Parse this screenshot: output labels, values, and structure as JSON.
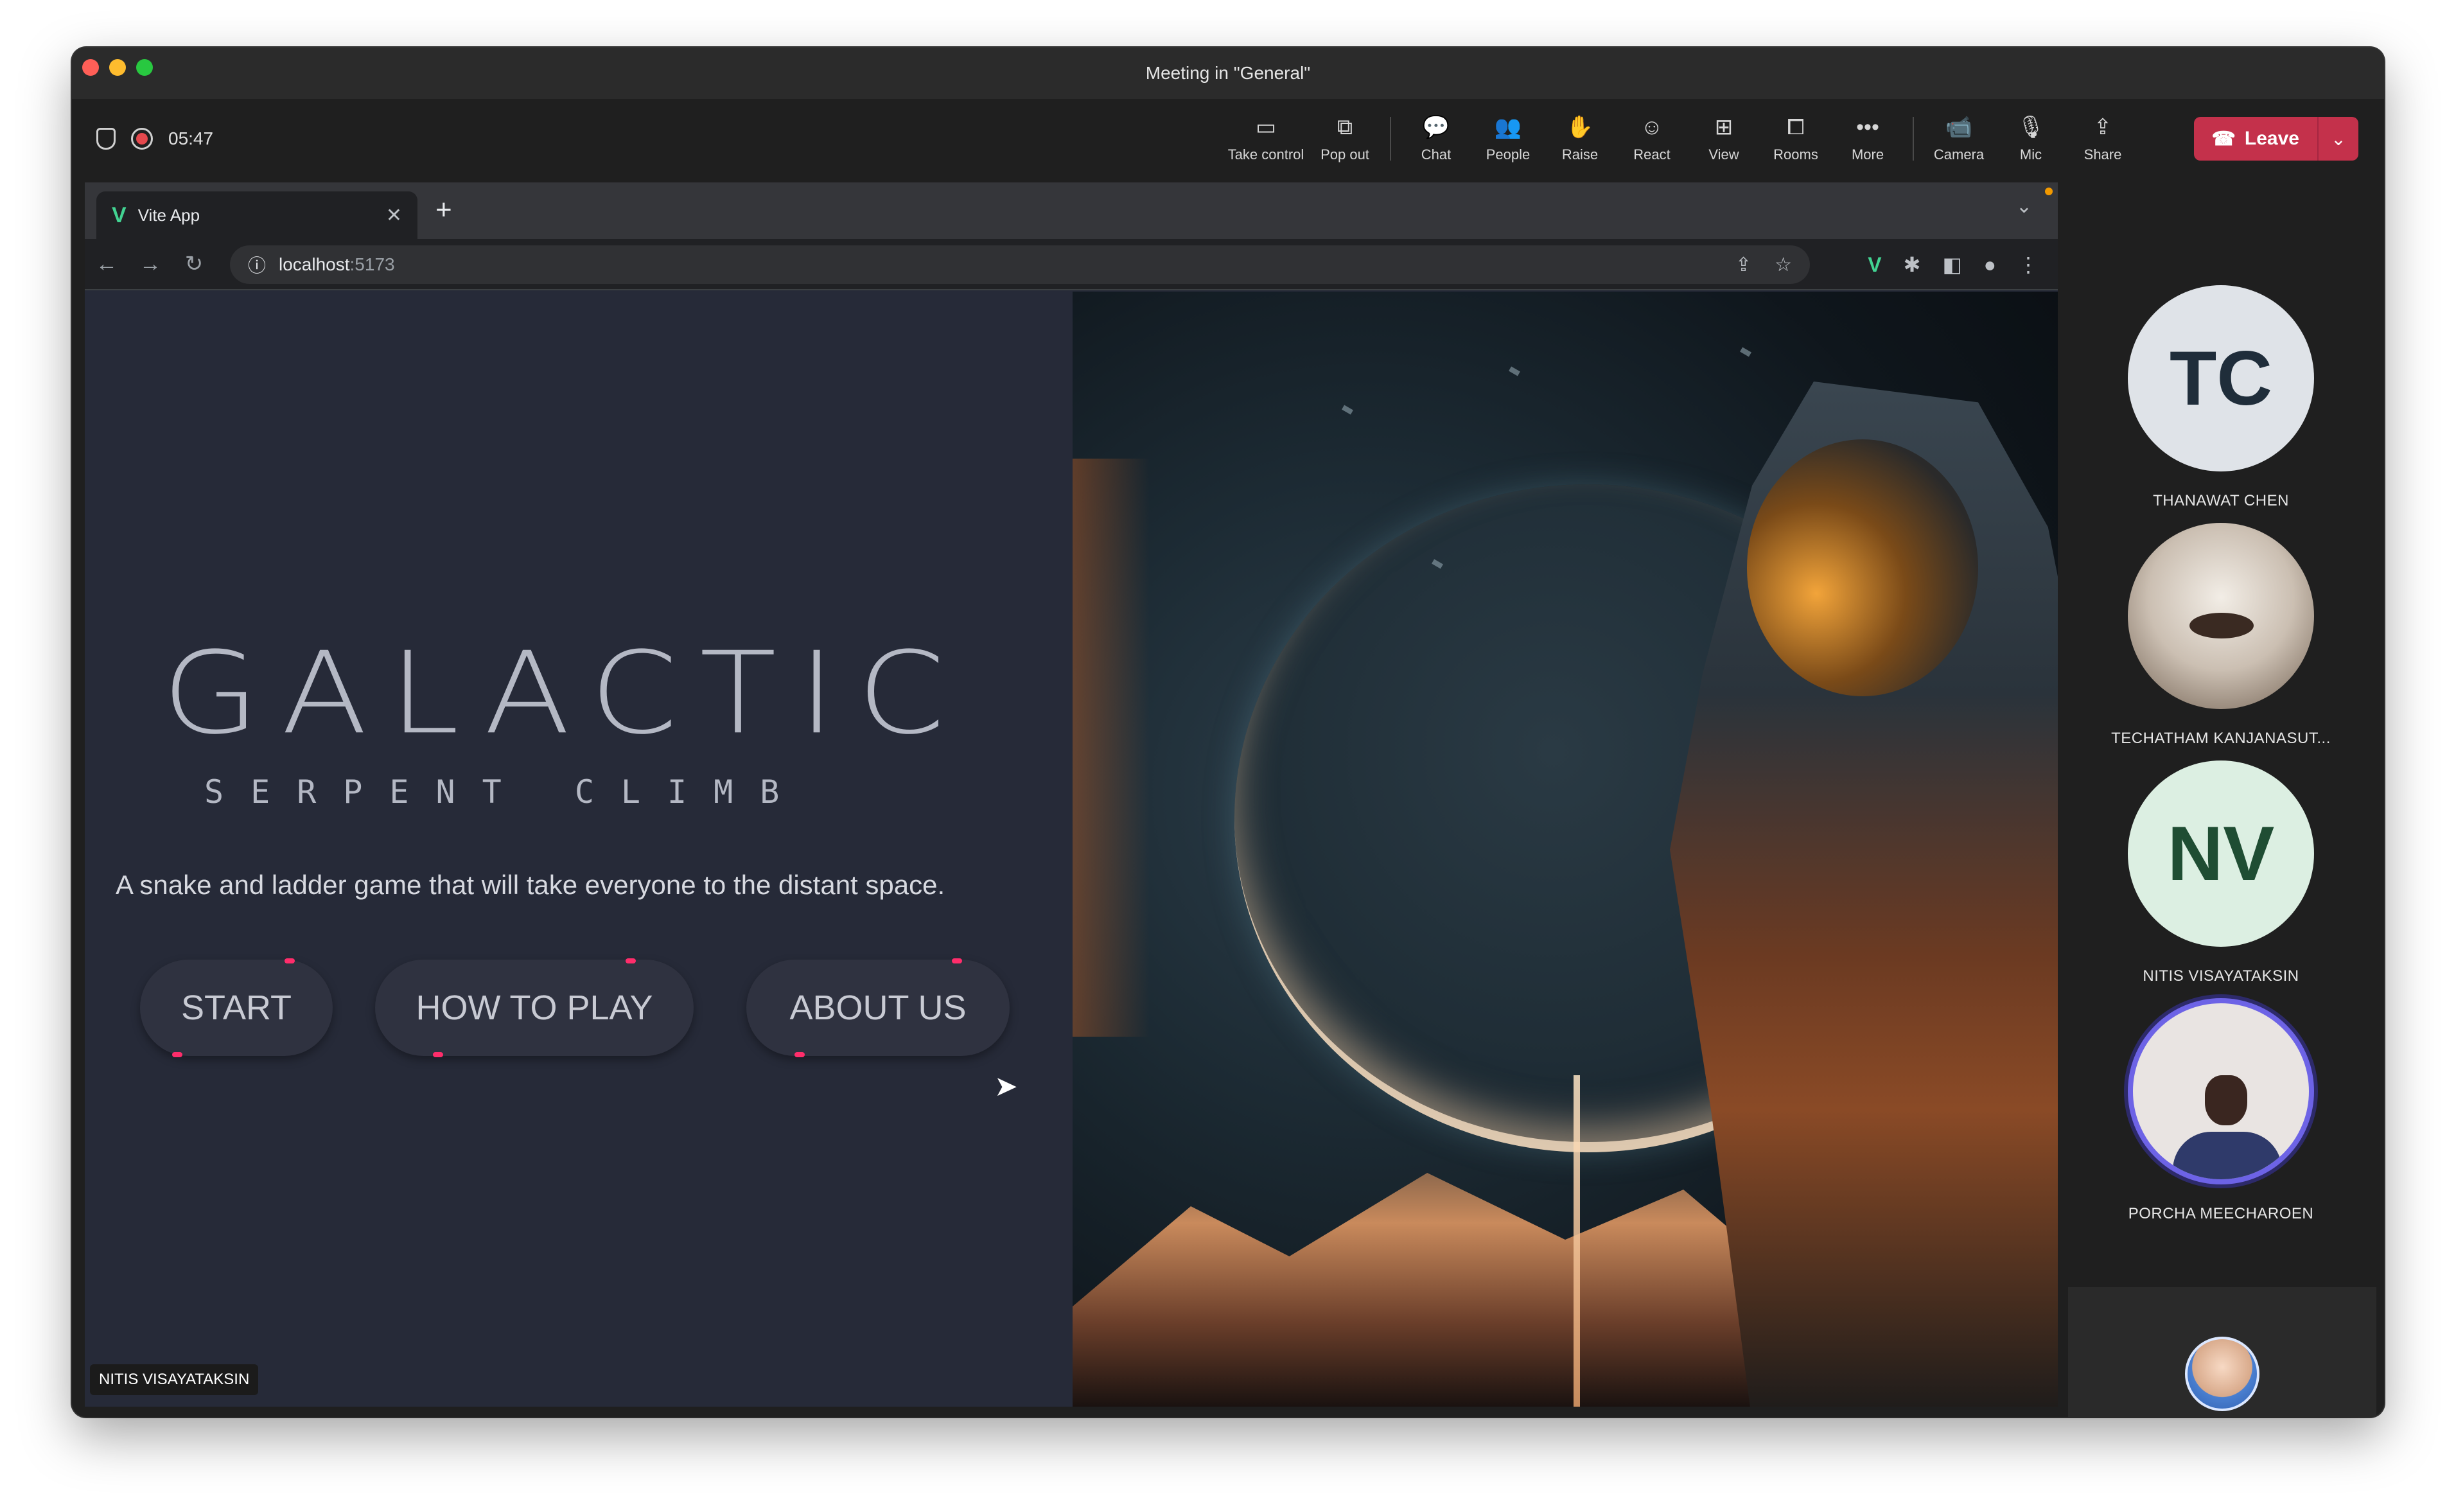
{
  "window": {
    "title": "Meeting in \"General\""
  },
  "meeting": {
    "timer": "05:47",
    "toolbar": [
      {
        "name": "take-control-button",
        "icon": "take-control-icon",
        "glyph": "▭",
        "label": "Take control",
        "wide": true
      },
      {
        "name": "pop-out-button",
        "icon": "pop-out-icon",
        "glyph": "⧉",
        "label": "Pop out"
      },
      {
        "sep": true
      },
      {
        "name": "chat-button",
        "icon": "chat-icon",
        "glyph": "💬",
        "label": "Chat"
      },
      {
        "name": "people-button",
        "icon": "people-icon",
        "glyph": "👥",
        "label": "People"
      },
      {
        "name": "raise-button",
        "icon": "raise-hand-icon",
        "glyph": "✋",
        "label": "Raise"
      },
      {
        "name": "react-button",
        "icon": "react-icon",
        "glyph": "☺",
        "label": "React"
      },
      {
        "name": "view-button",
        "icon": "view-grid-icon",
        "glyph": "⊞",
        "label": "View"
      },
      {
        "name": "rooms-button",
        "icon": "rooms-icon",
        "glyph": "⧠",
        "label": "Rooms"
      },
      {
        "name": "more-button",
        "icon": "more-icon",
        "glyph": "•••",
        "label": "More"
      },
      {
        "sep": true
      },
      {
        "name": "camera-button",
        "icon": "camera-off-icon",
        "glyph": "📹",
        "label": "Camera"
      },
      {
        "name": "mic-button",
        "icon": "mic-icon",
        "glyph": "🎙",
        "label": "Mic"
      },
      {
        "name": "share-button",
        "icon": "share-icon",
        "glyph": "⇪",
        "label": "Share"
      }
    ],
    "leave_label": "Leave"
  },
  "browser": {
    "tab_title": "Vite App",
    "url_host": "localhost",
    "url_port": ":5173"
  },
  "game": {
    "title": "GALACTIC",
    "subtitle": "SERPENT CLIMB",
    "tagline": "A snake and ladder game that will take everyone to the distant space.",
    "buttons": {
      "start": "START",
      "how_to_play": "HOW TO PLAY",
      "about_us": "ABOUT US"
    }
  },
  "participants": [
    {
      "initials": "TC",
      "name": "THANAWAT CHEN"
    },
    {
      "initials": "",
      "name": "TECHATHAM KANJANASUT..."
    },
    {
      "initials": "NV",
      "name": "NITIS VISAYATAKSIN"
    },
    {
      "initials": "",
      "name": "PORCHA MEECHAROEN"
    }
  ],
  "presenter_tag": "NITIS VISAYATAKSIN"
}
